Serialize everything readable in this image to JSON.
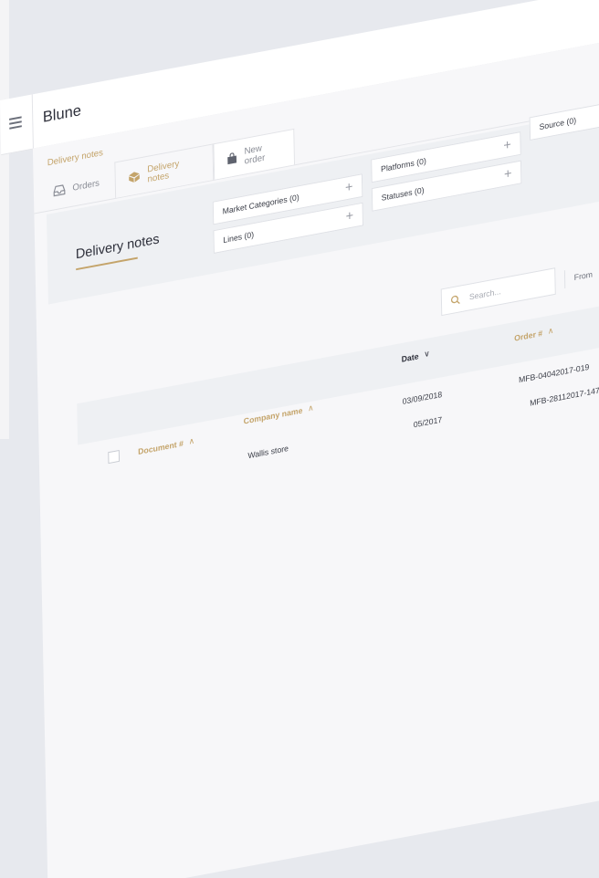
{
  "app": {
    "title": "Blune"
  },
  "breadcrumb": "Delivery notes",
  "tabs": [
    {
      "label": "Orders",
      "icon": "inbox-icon"
    },
    {
      "label": "Delivery notes",
      "icon": "box-icon"
    },
    {
      "label": "New order",
      "icon": "bag-icon"
    }
  ],
  "panel": {
    "title": "Delivery notes"
  },
  "filters": {
    "market_categories": "Market Categories (0)",
    "platforms": "Platforms (0)",
    "source": "Source (0)",
    "lines": "Lines (0)",
    "statuses": "Statuses (0)"
  },
  "search": {
    "placeholder": "Search..."
  },
  "date_filter": {
    "from_label": "From"
  },
  "table": {
    "columns": {
      "document": "Document #",
      "company": "Company name",
      "date": "Date",
      "order": "Order #"
    },
    "rows": [
      {
        "company": "Wallis store",
        "date": "03/09/2018",
        "order": "MFB-04042017-019"
      },
      {
        "company": "",
        "date": "05/2017",
        "order": "MFB-28112017-147"
      }
    ]
  },
  "colors": {
    "accent": "#c4a46a",
    "text": "#2d2f3a",
    "panel": "#eef0f3"
  }
}
